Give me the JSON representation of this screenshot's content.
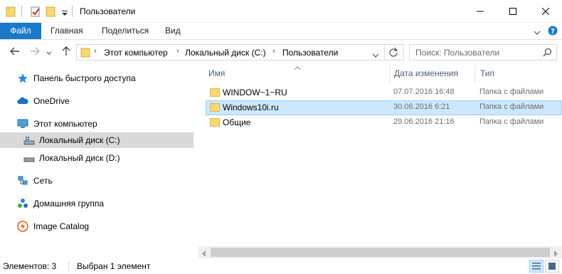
{
  "window": {
    "title": "Пользователи"
  },
  "ribbon": {
    "tabs": [
      "Файл",
      "Главная",
      "Поделиться",
      "Вид"
    ]
  },
  "address": {
    "crumbs": [
      "Этот компьютер",
      "Локальный диск (C:)",
      "Пользователи"
    ]
  },
  "search": {
    "placeholder": "Поиск: Пользователи"
  },
  "sidebar": {
    "items": [
      {
        "label": "Панель быстрого доступа",
        "icon": "star-icon"
      },
      {
        "label": "OneDrive",
        "icon": "cloud-icon"
      },
      {
        "label": "Этот компьютер",
        "icon": "computer-icon"
      },
      {
        "label": "Локальный диск (C:)",
        "icon": "drive-c-icon",
        "selected": true
      },
      {
        "label": "Локальный диск (D:)",
        "icon": "drive-icon"
      },
      {
        "label": "Сеть",
        "icon": "network-icon"
      },
      {
        "label": "Домашняя группа",
        "icon": "homegroup-icon"
      },
      {
        "label": "Image Catalog",
        "icon": "image-catalog-icon"
      }
    ]
  },
  "columns": {
    "name": "Имя",
    "date": "Дата изменения",
    "type": "Тип"
  },
  "files": [
    {
      "name": "WINDOW~1~RU",
      "date": "07.07.2016 16:48",
      "type": "Папка с файлами",
      "selected": false
    },
    {
      "name": "Windows10i.ru",
      "date": "30.06.2016 6:21",
      "type": "Папка с файлами",
      "selected": true
    },
    {
      "name": "Общие",
      "date": "29.06.2016 21:16",
      "type": "Папка с файлами",
      "selected": false
    }
  ],
  "status": {
    "count": "Элементов: 3",
    "selected": "Выбран 1 элемент"
  },
  "colors": {
    "accent": "#1979ca",
    "selection": "#cce8ff",
    "folder": "#f8d775"
  }
}
